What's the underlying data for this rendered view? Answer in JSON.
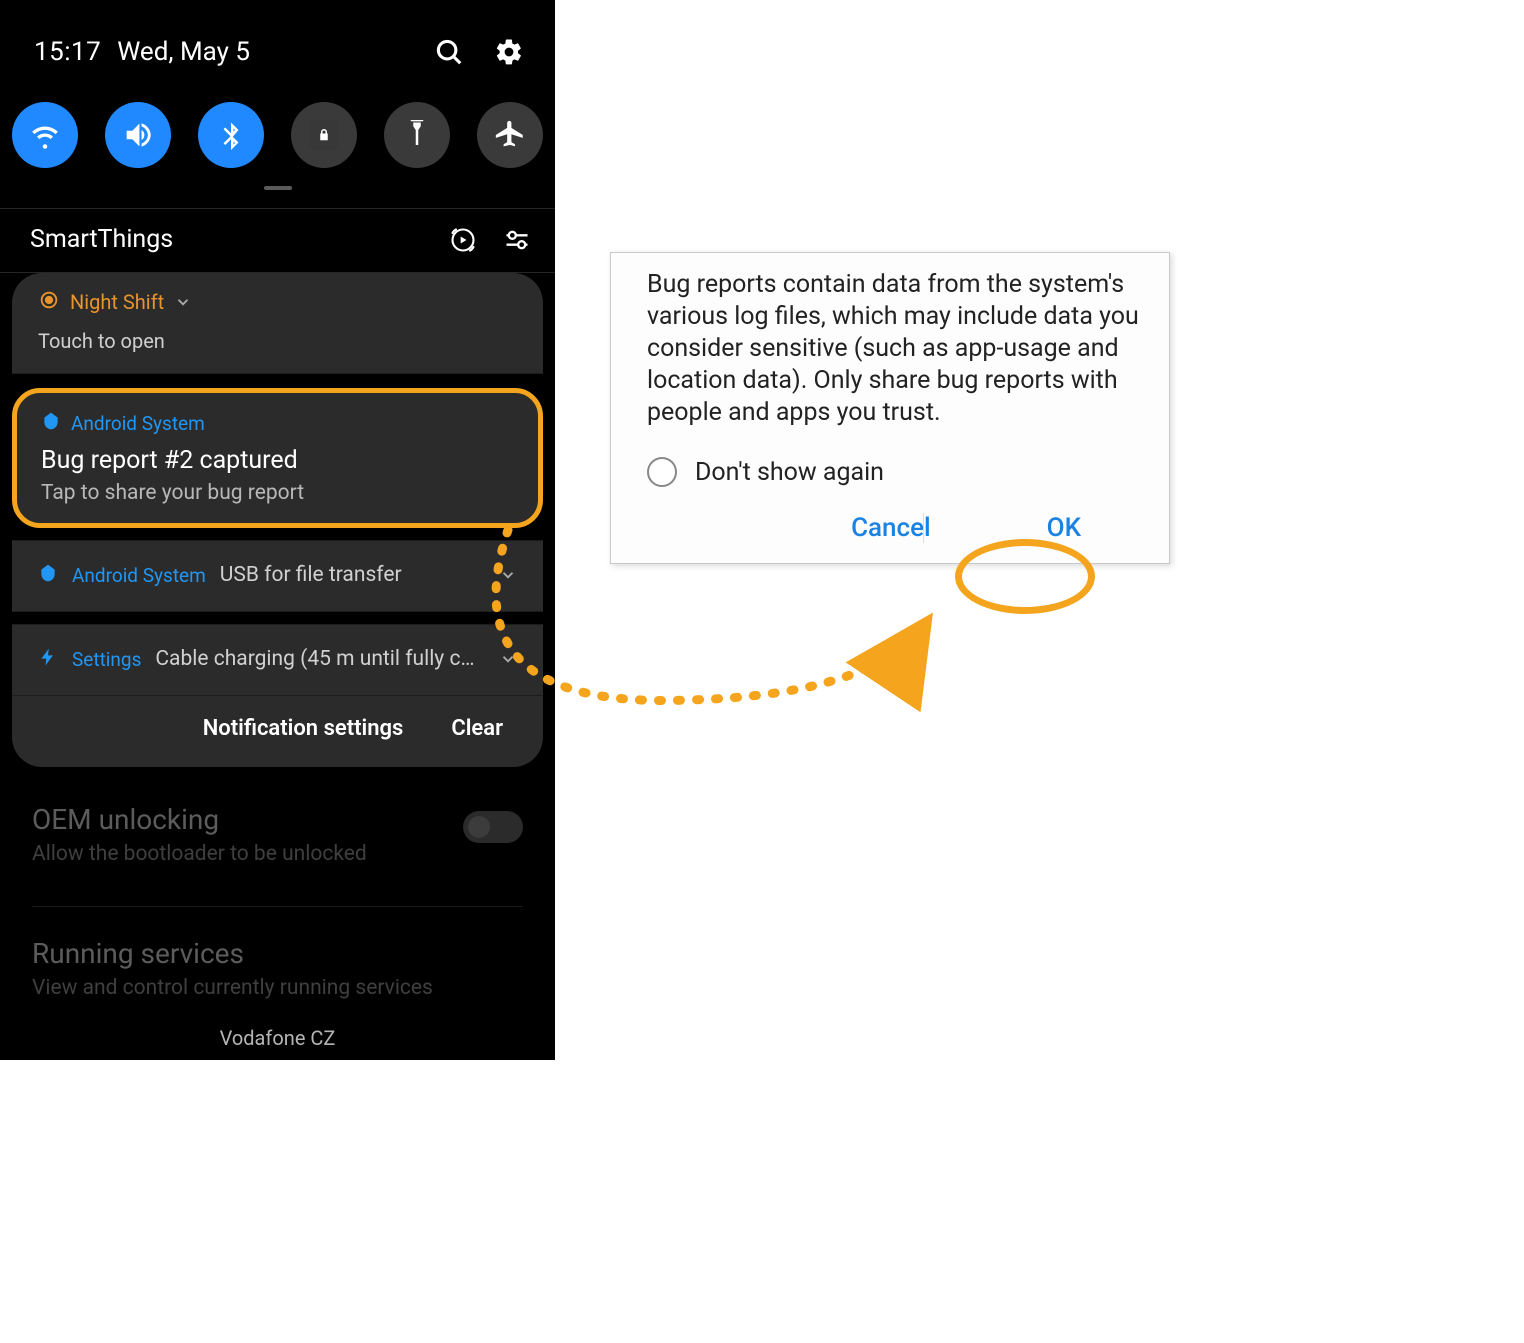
{
  "colors": {
    "accent_blue": "#2189ff",
    "text_orange": "#e8942a",
    "highlight_orange": "#f4a51d",
    "app_blue": "#2196f3",
    "dialog_blue": "#1a82e2"
  },
  "status": {
    "time": "15:17",
    "date": "Wed, May 5"
  },
  "quick_settings": [
    {
      "name": "wifi",
      "active": true
    },
    {
      "name": "sound",
      "active": true
    },
    {
      "name": "bluetooth",
      "active": true
    },
    {
      "name": "rotation-lock",
      "active": false
    },
    {
      "name": "flashlight",
      "active": false
    },
    {
      "name": "airplane",
      "active": false
    }
  ],
  "smartthings": {
    "title": "SmartThings"
  },
  "night_shift_card": {
    "title": "Night Shift",
    "body": "Touch to open"
  },
  "bug_notification": {
    "app": "Android System",
    "title": "Bug report #2 captured",
    "body": "Tap to share your bug report"
  },
  "usb_row": {
    "app": "Android System",
    "text": "USB for file transfer"
  },
  "charging_row": {
    "app": "Settings",
    "text": "Cable charging (45 m until fully charg…"
  },
  "actions": {
    "settings": "Notification settings",
    "clear": "Clear"
  },
  "dimmed_settings": {
    "row1_title": "OEM unlocking",
    "row1_sub": "Allow the bootloader to be unlocked",
    "row2_title": "Running services",
    "row2_sub": "View and control currently running services"
  },
  "carrier": "Vodafone CZ",
  "dialog": {
    "body": "Bug reports contain data from the system's various log files, which may include data you consider sensitive (such as app-usage and location data). Only share bug reports with people and apps you trust.",
    "checkbox": "Don't show again",
    "cancel": "Cancel",
    "ok": "OK"
  }
}
